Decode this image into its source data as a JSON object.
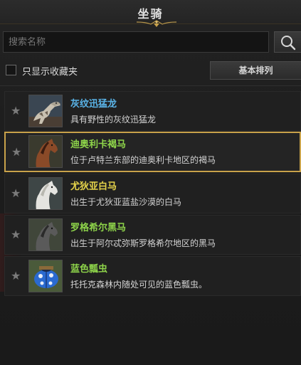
{
  "window": {
    "title": "坐骑"
  },
  "search": {
    "placeholder": "搜索名称"
  },
  "filter": {
    "checkbox_label": "只显示收藏夹",
    "checked": false,
    "sort_label": "基本排列"
  },
  "colors": {
    "accent": "#c9a24a",
    "name_blue": "#5ab4e8",
    "name_green": "#8ed44a",
    "name_yellow": "#e4d24a"
  },
  "mounts": [
    {
      "name": "灰纹迅猛龙",
      "desc": "具有野性的灰纹迅猛龙",
      "name_color": "#5ab4e8",
      "icon": "raptor-icon",
      "favorite": false,
      "selected": false
    },
    {
      "name": "迪奥利卡褐马",
      "desc": "位于卢特兰东部的迪奥利卡地区的褐马",
      "name_color": "#8ed44a",
      "icon": "brown-horse-icon",
      "favorite": false,
      "selected": true
    },
    {
      "name": "尤狄亚白马",
      "desc": "出生于尤狄亚蓝盐沙漠的白马",
      "name_color": "#e4d24a",
      "icon": "white-horse-icon",
      "favorite": false,
      "selected": false
    },
    {
      "name": "罗格希尔黑马",
      "desc": "出生于阿尔忒弥斯罗格希尔地区的黑马",
      "name_color": "#8ed44a",
      "icon": "black-horse-icon",
      "favorite": false,
      "selected": false
    },
    {
      "name": "蓝色瓢虫",
      "desc": "托托克森林内随处可见的蓝色瓢虫。",
      "name_color": "#8ed44a",
      "icon": "ladybug-icon",
      "favorite": false,
      "selected": false
    }
  ]
}
